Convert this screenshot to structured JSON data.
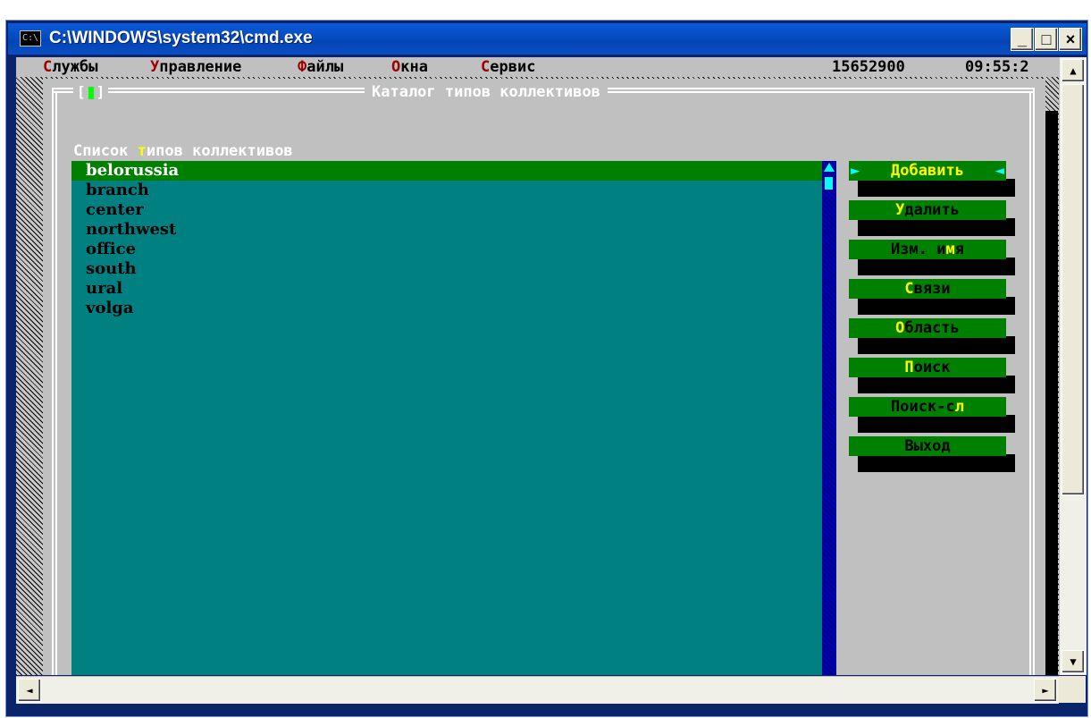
{
  "window": {
    "title": "C:\\WINDOWS\\system32\\cmd.exe",
    "icon": "C:\\",
    "minimize": "_",
    "maximize": "□",
    "close": "×"
  },
  "menu": {
    "items": [
      {
        "hot": "С",
        "rest": "лужбы"
      },
      {
        "hot": "У",
        "rest": "правление"
      },
      {
        "hot": "Ф",
        "rest": "айлы"
      },
      {
        "hot": "О",
        "rest": "кна"
      },
      {
        "hot": "С",
        "rest": "ервис"
      }
    ],
    "counter": "15652900",
    "time": "09:55:2"
  },
  "dialog": {
    "title": "Каталог типов коллективов",
    "list_label_a": "Список ",
    "list_label_hk": "т",
    "list_label_b": "ипов коллективов",
    "items": [
      "belorussia",
      "branch",
      "center",
      "northwest",
      "office",
      "south",
      "ural",
      "volga"
    ],
    "selected_index": 0
  },
  "buttons": {
    "add": {
      "hk": "Д",
      "rest": "обавить"
    },
    "delete": {
      "hk": "У",
      "rest": "далить"
    },
    "rename": {
      "a": "Изм. и",
      "hk": "м",
      "b": "я"
    },
    "links": {
      "hk": "С",
      "rest": "вязи"
    },
    "area": {
      "hk": "О",
      "rest": "бласть"
    },
    "search": {
      "hk": "П",
      "rest": "оиск"
    },
    "search_next": {
      "a": "Поиск-с",
      "hk": "л"
    },
    "exit": {
      "label": "Выход"
    }
  },
  "scroll": {
    "up": "▲",
    "down": "▼",
    "left": "◄",
    "right": "►"
  },
  "colors": {
    "listbox": "#008080",
    "selected": "#008000",
    "button": "#008000",
    "hotkey": "#ffff00"
  }
}
